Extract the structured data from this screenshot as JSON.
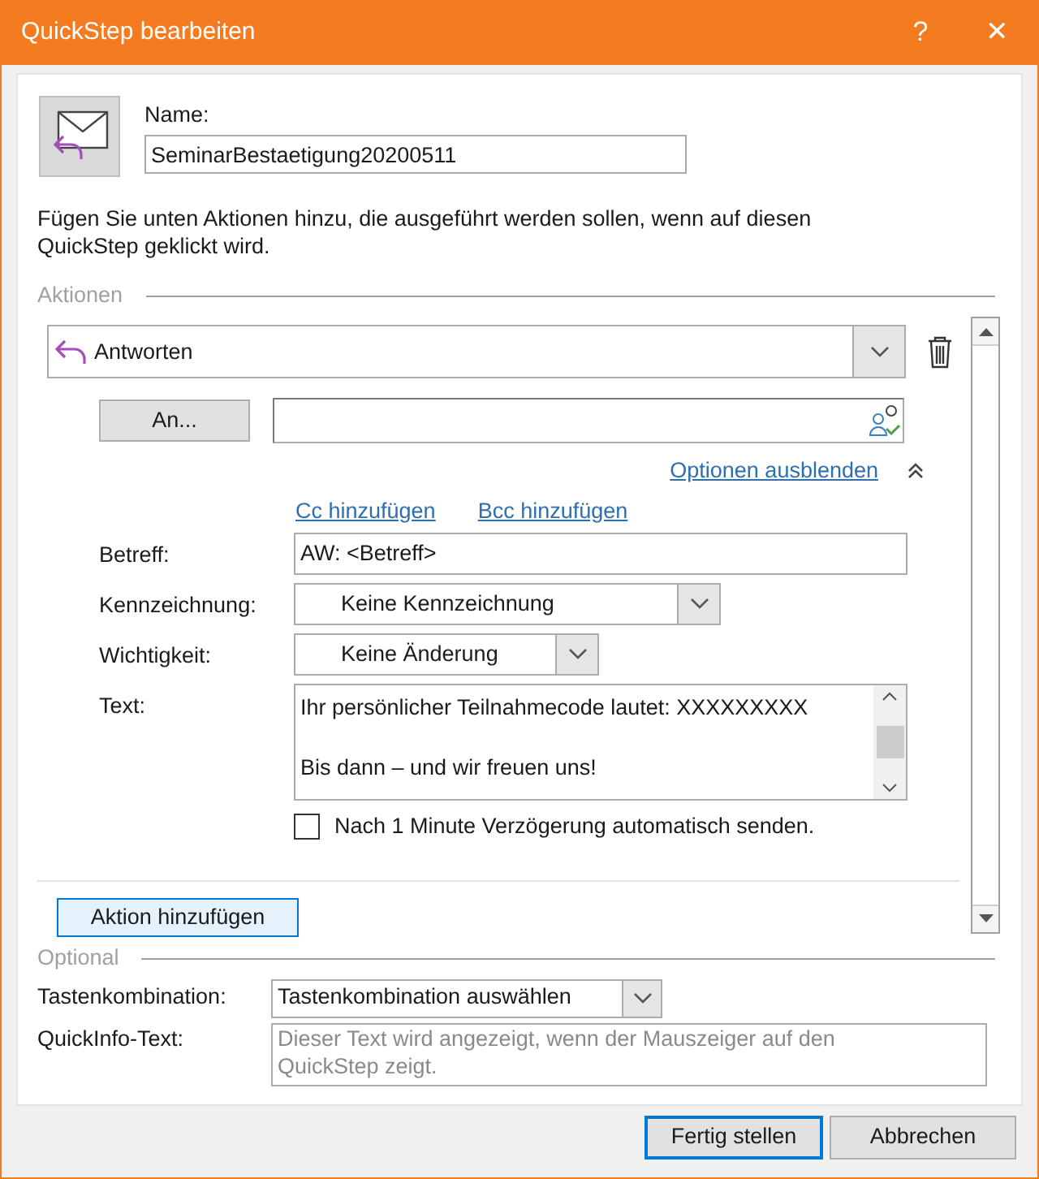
{
  "window": {
    "title": "QuickStep bearbeiten",
    "help": "?",
    "close": "✕"
  },
  "name": {
    "label": "Name:",
    "value": "SeminarBestaetigung20200511"
  },
  "description": "Fügen Sie unten Aktionen hinzu, die ausgeführt werden sollen, wenn auf diesen QuickStep geklickt wird.",
  "actions": {
    "legend": "Aktionen",
    "action": "Antworten",
    "to_button": "An...",
    "options_link": "Optionen ausblenden",
    "cc_link": "Cc hinzufügen",
    "bcc_link": "Bcc hinzufügen",
    "fields": [
      {
        "kind": "text",
        "label": "Betreff:",
        "value": "AW: <Betreff>"
      },
      {
        "kind": "select",
        "label": "Kennzeichnung:",
        "value": "Keine Kennzeichnung"
      },
      {
        "kind": "select",
        "label": "Wichtigkeit:",
        "value": "Keine Änderung"
      },
      {
        "kind": "textarea",
        "label": "Text:",
        "lines": [
          "Ihr persönlicher Teilnahmecode lautet: XXXXXXXXX",
          "Bis dann – und wir freuen uns!"
        ]
      }
    ],
    "auto_send": {
      "label": "Nach 1 Minute Verzögerung automatisch senden.",
      "checked": false
    },
    "add_button": "Aktion hinzufügen"
  },
  "optional": {
    "legend": "Optional",
    "shortcut": {
      "label": "Tastenkombination:",
      "value": "Tastenkombination auswählen"
    },
    "tooltip": {
      "label": "QuickInfo-Text:",
      "placeholder": "Dieser Text wird angezeigt, wenn der Mauszeiger auf den QuickStep zeigt."
    }
  },
  "buttons": [
    {
      "label": "Fertig stellen",
      "default": true
    },
    {
      "label": "Abbrechen",
      "default": false
    }
  ]
}
